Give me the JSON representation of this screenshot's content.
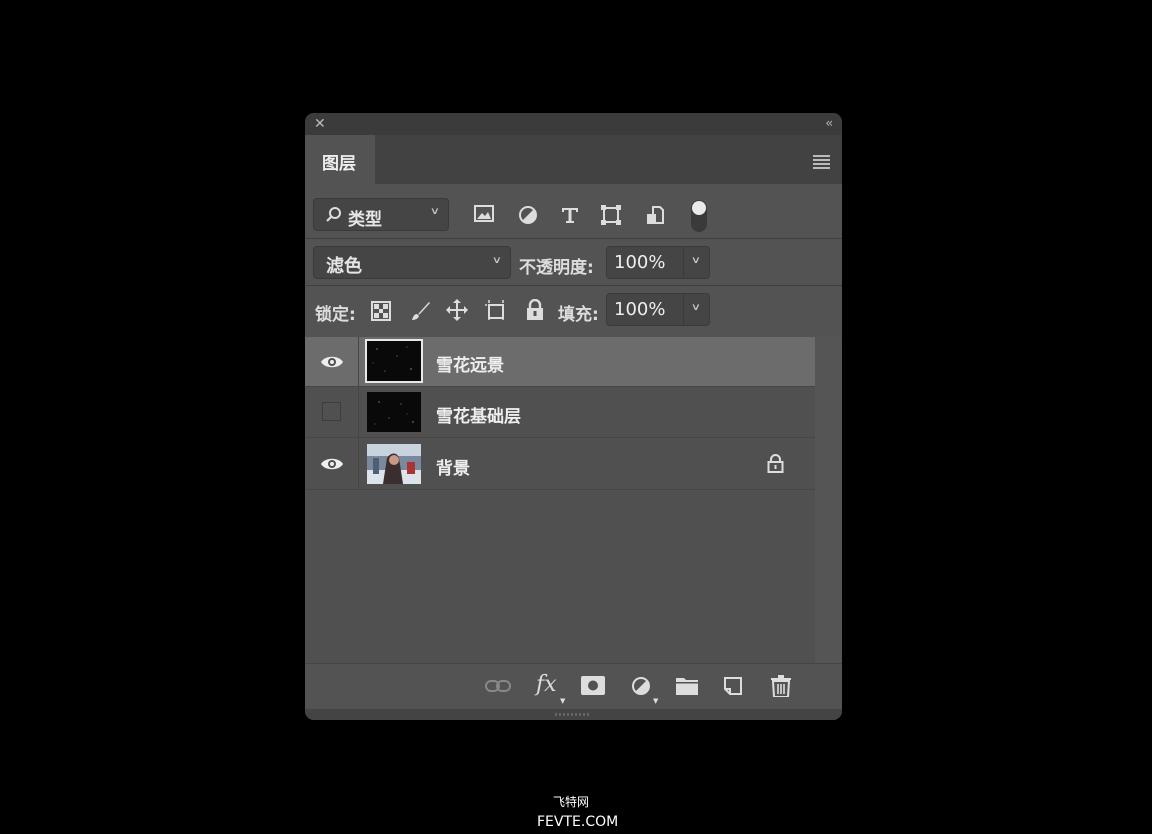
{
  "panel": {
    "close_glyph": "✕",
    "collapse_glyph": "‹‹",
    "tab_label": "图层"
  },
  "filter": {
    "kind_label": "类型",
    "icons": [
      "image-filter-icon",
      "adjustment-filter-icon",
      "type-filter-icon",
      "shape-filter-icon",
      "smart-object-filter-icon",
      "filter-toggle-icon"
    ]
  },
  "blend": {
    "mode": "滤色",
    "opacity_label": "不透明度:",
    "opacity_value": "100%"
  },
  "lock": {
    "label": "锁定:",
    "icons": [
      "lock-transparent-icon",
      "lock-pixels-icon",
      "lock-position-icon",
      "lock-artboard-icon",
      "lock-all-icon"
    ],
    "fill_label": "填充:",
    "fill_value": "100%"
  },
  "layers": [
    {
      "name": "雪花远景",
      "visible": true,
      "selected": true,
      "locked": false
    },
    {
      "name": "雪花基础层",
      "visible": false,
      "selected": false,
      "locked": false
    },
    {
      "name": "背景",
      "visible": true,
      "selected": false,
      "locked": true
    }
  ],
  "bottom_icons": [
    "link-layers-icon",
    "fx-icon",
    "add-mask-icon",
    "new-adjustment-icon",
    "new-group-icon",
    "new-layer-icon",
    "delete-layer-icon"
  ],
  "fx_label": "fx",
  "watermark": {
    "line1": "飞特网",
    "line2": "FEVTE.COM"
  }
}
